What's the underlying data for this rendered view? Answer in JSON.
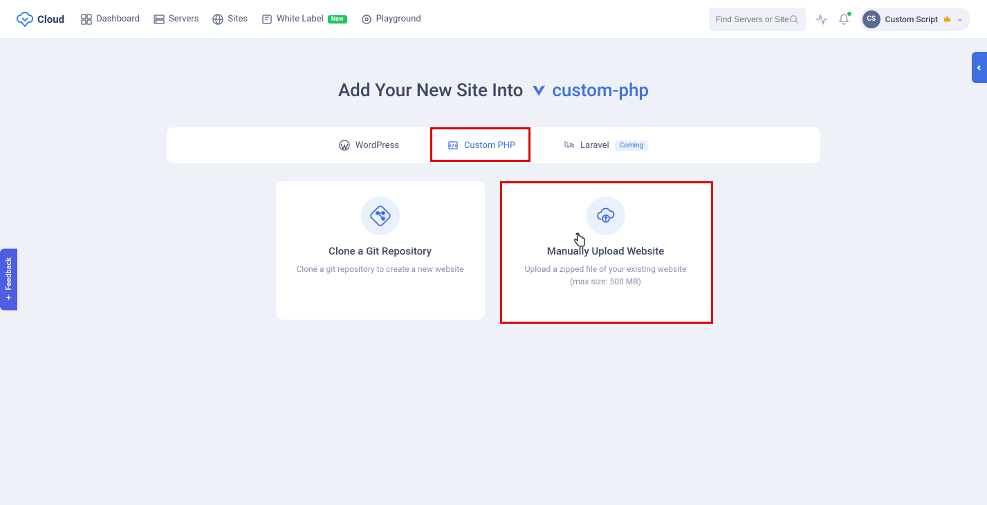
{
  "brand": "Cloud",
  "nav": {
    "dashboard": "Dashboard",
    "servers": "Servers",
    "sites": "Sites",
    "whitelabel": "White Label",
    "whitelabel_badge": "New",
    "playground": "Playground"
  },
  "search": {
    "placeholder": "Find Servers or Sites"
  },
  "user": {
    "initials": "CS",
    "name": "Custom Script"
  },
  "page": {
    "title_prefix": "Add Your New Site Into",
    "server_name": "custom-php"
  },
  "tabs": {
    "wordpress": "WordPress",
    "customphp": "Custom PHP",
    "laravel": "Laravel",
    "laravel_badge": "Coming"
  },
  "cards": {
    "git": {
      "title": "Clone a Git Repository",
      "desc": "Clone a git repository to create a new website"
    },
    "upload": {
      "title": "Manually Upload Website",
      "desc": "Upload a zipped file of your existing website (max size: 500 MB)"
    }
  },
  "feedback": "Feedback"
}
